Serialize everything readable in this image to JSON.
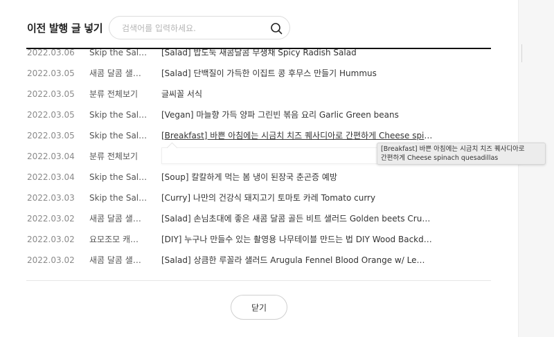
{
  "dialog": {
    "title": "이전 발행 글 넣기",
    "search": {
      "placeholder": "검색어를 입력하세요.",
      "value": "",
      "icon": "search-icon"
    },
    "close_label": "닫기"
  },
  "posts": [
    {
      "date": "2022.03.06",
      "category": "Skip the Sal…",
      "title": "[Salad] 밥도둑 새콤달콤 무생채 Spicy Radish Salad"
    },
    {
      "date": "2022.03.05",
      "category": "새콤 달콤 샐…",
      "title": "[Salad] 단백질이 가득한 이집트 콩 후무스 만들기 Hummus"
    },
    {
      "date": "2022.03.05",
      "category": "분류 전체보기",
      "title": "글씨꼴 서식"
    },
    {
      "date": "2022.03.05",
      "category": "Skip the Sal…",
      "title": "[Vegan] 마늘향 가득 양파 그린빈 볶음 요리 Garlic Green beans"
    },
    {
      "date": "2022.03.05",
      "category": "Skip the Sal…",
      "title": "[Breakfast] 바쁜 아침에는 시금치 치즈 퀘사디아로 간편하게 Cheese spina…"
    },
    {
      "date": "2022.03.04",
      "category": "분류 전체보기",
      "title": ""
    },
    {
      "date": "2022.03.04",
      "category": "Skip the Sal…",
      "title": "[Soup] 칼칼하게 먹는 봄 냉이 된장국 춘곤증 예방"
    },
    {
      "date": "2022.03.03",
      "category": "Skip the Sal…",
      "title": "[Curry] 나만의 건강식 돼지고기 토마토 카레 Tomato curry"
    },
    {
      "date": "2022.03.02",
      "category": "새콤 달콤 샐…",
      "title": "[Salad] 손님초대에 좋은 새콤 달콤 골든 비트 샐러드 Golden beets Crunc…"
    },
    {
      "date": "2022.03.02",
      "category": "요모조모 캐…",
      "title": "[DIY] 누구나 만들수 있는 촬영용 나무테이블 만드는 법 DIY Wood Backdro…"
    },
    {
      "date": "2022.03.02",
      "category": "새콤 달콤 샐…",
      "title": "[Salad] 상큼한 루꼴라 샐러드 Arugula Fennel Blood Orange w/ Lemon …"
    }
  ],
  "tooltip": {
    "line1": "[Breakfast] 바쁜 아침에는 시금치 치즈 퀘사디아로",
    "line2": "간편하게 Cheese spinach quesadillas"
  }
}
